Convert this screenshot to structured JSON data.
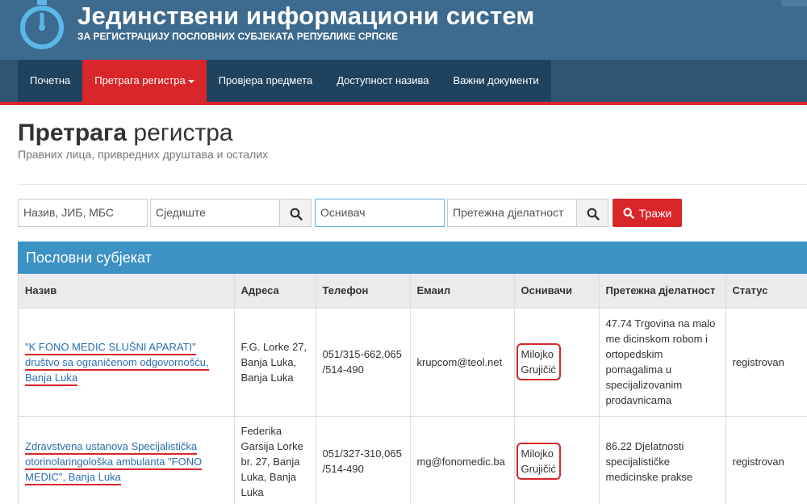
{
  "header": {
    "title": "Јединствени информациони систем",
    "subtitle": "ЗА РЕГИСТРАЦИЈУ ПОСЛОВНИХ СУБЈЕКАТА РЕПУБЛИКЕ СРПСКЕ"
  },
  "nav": {
    "items": [
      "Почетна",
      "Претрага регистра",
      "Провјера предмета",
      "Доступност назива",
      "Важни документи"
    ],
    "active_index": 1
  },
  "page": {
    "title_bold": "Претрага",
    "title_rest": "регистра",
    "subtitle": "Правних лица, привредних друштава и осталих"
  },
  "search": {
    "name_placeholder": "Назив, ЈИБ, МБС",
    "seat_placeholder": "Сједиште",
    "founder_placeholder": "Оснивач",
    "activity_placeholder": "Претежна дјелатност",
    "submit_label": "Тражи"
  },
  "panel": {
    "title": "Пословни субјекат",
    "columns": [
      "Назив",
      "Адреса",
      "Телефон",
      "Емаил",
      "Оснивачи",
      "Претежна дјелатност",
      "Статус"
    ],
    "rows": [
      {
        "name_lines": [
          "\"K FONO MEDIC SLUŠNI APARATI\"",
          "društvo sa ograničenom odgovornošću,",
          "Banja Luka"
        ],
        "address": "F.G. Lorke 27, Banja Luka, Banja Luka",
        "phone": "051/315-662,065 /514-490",
        "email": "krupcom@teol.net",
        "founder_lines": [
          "Milojko",
          "Grujičić"
        ],
        "activity": "47.74 Trgovina na malo me dicinskom robom i ortopedskim pomagalima u specijalizovanim prodavnicama",
        "status": "registrovan"
      },
      {
        "name_lines": [
          "Zdravstvena ustanova Specijalistička",
          "otorinolaringološka ambulanta \"FONO",
          "MEDIC\", Banja Luka"
        ],
        "address": "Federika Garsija Lorke br. 27, Banja Luka, Banja Luka",
        "phone": "051/327-310,065 /514-490",
        "email": "mg@fonomedic.ba",
        "founder_lines": [
          "Milojko",
          "Grujičić"
        ],
        "activity": "86.22 Djelatnosti specijalističke medicinske prakse",
        "status": "registrovan"
      }
    ]
  },
  "colors": {
    "header_bg": "#3d6a8f",
    "nav_bg": "#2e5574",
    "accent_red": "#d9262b",
    "panel_blue": "#3c92c5",
    "link_blue": "#2a6fb0"
  },
  "icons": [
    "stopwatch-logo-icon",
    "caret-down-icon",
    "search-icon"
  ]
}
